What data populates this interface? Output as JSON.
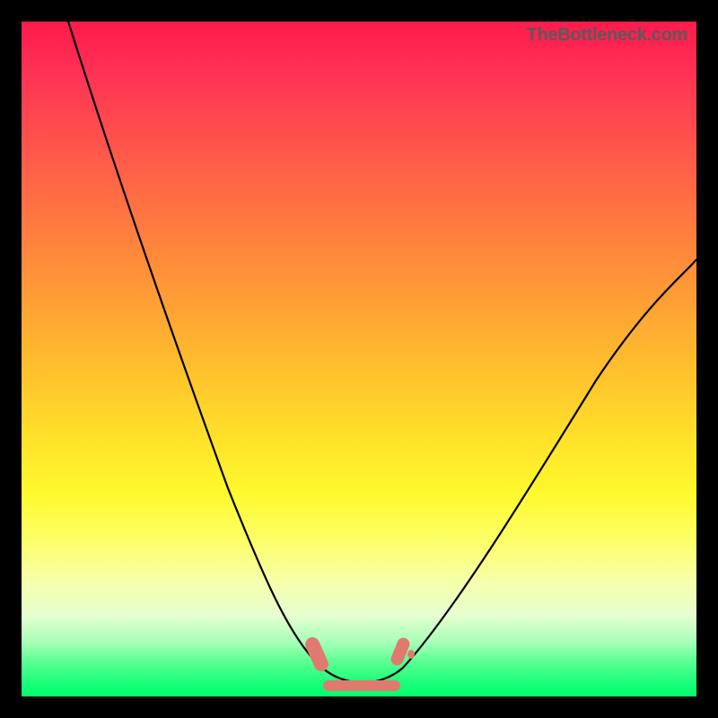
{
  "watermark": "TheBottleneck.com",
  "colors": {
    "background_black": "#000000",
    "gradient_top": "#ff1a4d",
    "gradient_bottom": "#00ff6a",
    "curve": "#000000",
    "marker": "#e07a6e"
  },
  "chart_data": {
    "type": "line",
    "title": "",
    "xlabel": "",
    "ylabel": "",
    "xlim": [
      0,
      100
    ],
    "ylim": [
      0,
      100
    ],
    "series": [
      {
        "name": "bottleneck-curve",
        "x": [
          7,
          12,
          18,
          24,
          30,
          36,
          40,
          43,
          45,
          48,
          50,
          53,
          56,
          60,
          66,
          74,
          82,
          90,
          98
        ],
        "y": [
          100,
          86,
          70,
          55,
          40,
          26,
          16,
          9,
          4,
          1,
          0,
          1,
          4,
          10,
          20,
          34,
          48,
          58,
          65
        ]
      }
    ],
    "markers": [
      {
        "name": "left-blob",
        "x": 44,
        "y": 4
      },
      {
        "name": "right-blob",
        "x": 55,
        "y": 4
      },
      {
        "name": "bottom-bar",
        "x_start": 45,
        "x_end": 55,
        "y": 0
      }
    ],
    "annotations": []
  }
}
